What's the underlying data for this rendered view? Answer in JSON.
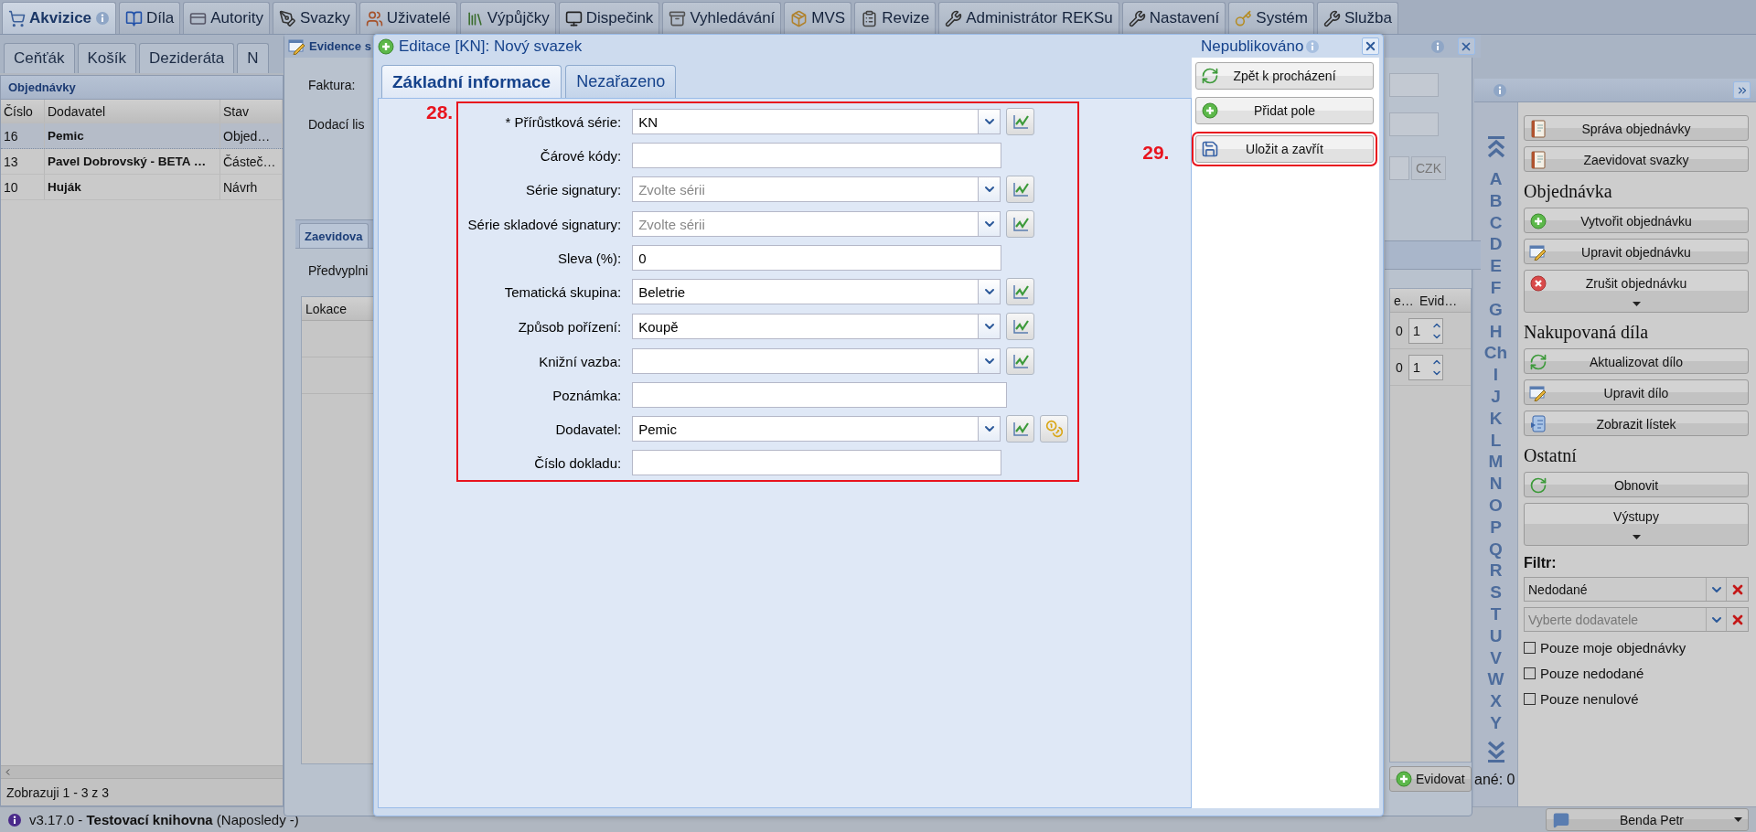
{
  "main_tabs": [
    {
      "label": "Akvizice",
      "selected": true
    },
    {
      "label": "Díla",
      "selected": false
    },
    {
      "label": "Autority",
      "selected": false
    },
    {
      "label": "Svazky",
      "selected": false
    },
    {
      "label": "Uživatelé",
      "selected": false
    },
    {
      "label": "Výpůjčky",
      "selected": false
    },
    {
      "label": "Dispečink",
      "selected": false
    },
    {
      "label": "Vyhledávání",
      "selected": false
    },
    {
      "label": "MVS",
      "selected": false
    },
    {
      "label": "Revize",
      "selected": false
    },
    {
      "label": "Administrátor REKSu",
      "selected": false
    },
    {
      "label": "Nastavení",
      "selected": false
    },
    {
      "label": "Systém",
      "selected": false
    },
    {
      "label": "Služba",
      "selected": false
    }
  ],
  "sub_tabs": [
    {
      "label": "Ceňťák",
      "selected": false
    },
    {
      "label": "Košík",
      "selected": false
    },
    {
      "label": "Dezideráta",
      "selected": false
    },
    {
      "label": "N",
      "selected": false
    }
  ],
  "orders": {
    "title": "Objednávky",
    "columns": [
      "Číslo",
      "Dodavatel",
      "Stav"
    ],
    "rows": [
      {
        "cells": [
          "16",
          "Pemic",
          "Objed…"
        ],
        "selected": true
      },
      {
        "cells": [
          "13",
          "Pavel Dobrovský - BETA …",
          "Částeč…"
        ],
        "selected": false
      },
      {
        "cells": [
          "10",
          "Huják",
          "Návrh"
        ],
        "selected": false
      }
    ],
    "footer": "Zobrazuji 1 - 3 z 3"
  },
  "evidence_window": {
    "title": "Evidence s",
    "labels": [
      "Faktura:",
      "Dodací lis"
    ],
    "currency": "CZK",
    "tab": "Zaevidova",
    "prefill_label": "Předvyplni",
    "left_columns": [
      "Lokace"
    ],
    "right_columns": [
      "e…",
      "Evid…"
    ],
    "rows": [
      {
        "value": "0",
        "count": "1"
      },
      {
        "value": "0",
        "count": "1"
      }
    ],
    "button": "Evidovat"
  },
  "editor": {
    "title": "Editace [KN]: Nový svazek",
    "publish_status": "Nepublikováno",
    "tabs": [
      {
        "label": "Základní informace",
        "selected": true
      },
      {
        "label": "Nezařazeno",
        "selected": false
      }
    ],
    "form_callout": "28.",
    "actions_callout": "29.",
    "fields": [
      {
        "kind": "combo",
        "label": "* Přírůstková série:",
        "value": "KN",
        "lookup": false
      },
      {
        "kind": "text",
        "label": "Čárové kódy:"
      },
      {
        "kind": "combo",
        "label": "Série signatury:",
        "placeholder": "Zvolte sérii",
        "lookup": false
      },
      {
        "kind": "combo",
        "label": "Série skladové signatury:",
        "placeholder": "Zvolte sérii",
        "lookup": false
      },
      {
        "kind": "text",
        "label": "Sleva (%):",
        "value": "0"
      },
      {
        "kind": "combo",
        "label": "Tematická skupina:",
        "value": "Beletrie",
        "lookup": false
      },
      {
        "kind": "combo",
        "label": "Způsob pořízení:",
        "value": "Koupě",
        "lookup": false
      },
      {
        "kind": "combo",
        "label": "Knižní vazba:",
        "lookup": false
      },
      {
        "kind": "memo",
        "label": "Poznámka:"
      },
      {
        "kind": "combo",
        "label": "Dodavatel:",
        "value": "Pemic",
        "lookup": true
      },
      {
        "kind": "text",
        "label": "Číslo dokladu:"
      }
    ],
    "actions": [
      {
        "kind": "back",
        "label": "Zpět k procházení",
        "highlighted": false
      },
      {
        "kind": "add",
        "label": "Přidat pole",
        "highlighted": false
      },
      {
        "kind": "save",
        "label": "Uložit a zavřít",
        "highlighted": true
      }
    ]
  },
  "alphabet": {
    "letters": [
      "A",
      "B",
      "C",
      "D",
      "E",
      "F",
      "G",
      "H",
      "Ch",
      "I",
      "J",
      "K",
      "L",
      "M",
      "N",
      "O",
      "P",
      "Q",
      "R",
      "S",
      "T",
      "U",
      "V",
      "W",
      "X",
      "Y"
    ],
    "status": "ané: 0"
  },
  "sidebar": {
    "items": [
      {
        "kind": "book",
        "label": "Správa objednávky",
        "menu": false
      },
      {
        "kind": "book",
        "label": "Zaevidovat svazky",
        "menu": false
      },
      {
        "kind": "heading",
        "label": "Objednávka"
      },
      {
        "kind": "add",
        "label": "Vytvořit objednávku",
        "menu": false
      },
      {
        "kind": "edit",
        "label": "Upravit objednávku",
        "menu": false
      },
      {
        "kind": "remove",
        "label": "Zrušit objednávku",
        "menu": true
      },
      {
        "kind": "heading",
        "label": "Nakupovaná díla"
      },
      {
        "kind": "sync",
        "label": "Aktualizovat dílo",
        "menu": false
      },
      {
        "kind": "edit",
        "label": "Upravit dílo",
        "menu": false
      },
      {
        "kind": "card",
        "label": "Zobrazit lístek",
        "menu": false
      },
      {
        "kind": "heading",
        "label": "Ostatní"
      },
      {
        "kind": "reload",
        "label": "Obnovit",
        "menu": false
      },
      {
        "kind": "plain",
        "label": "Výstupy",
        "menu": true
      },
      {
        "kind": "label",
        "label": "Filtr:"
      },
      {
        "kind": "combo",
        "value": "Nedodané"
      },
      {
        "kind": "combo",
        "placeholder": "Vyberte dodavatele"
      },
      {
        "kind": "checkbox",
        "label": "Pouze moje objednávky",
        "checked": false
      },
      {
        "kind": "checkbox",
        "label": "Pouze nedodané",
        "checked": false
      },
      {
        "kind": "checkbox",
        "label": "Pouze nenulové",
        "checked": false
      }
    ]
  },
  "status_bar": {
    "text": "v3.17.0 - **Testovací knihovna** (Naposledy -)",
    "user": "Benda Petr"
  }
}
